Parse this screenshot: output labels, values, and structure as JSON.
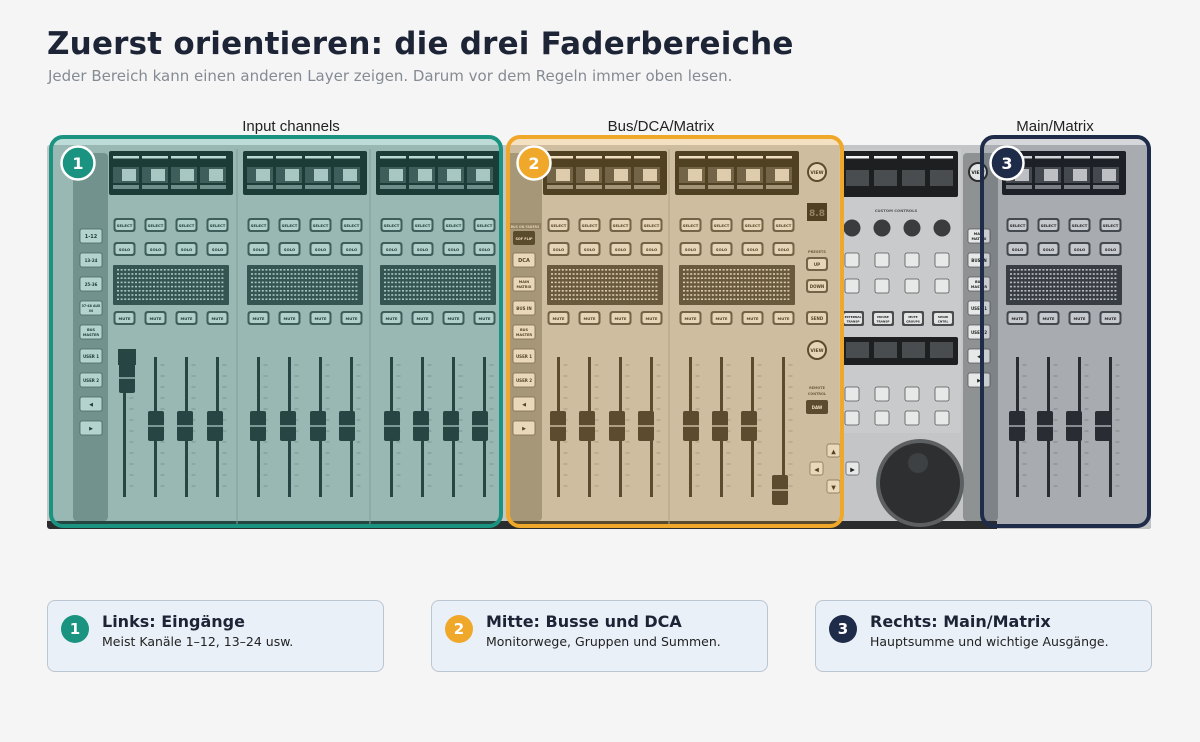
{
  "header": {
    "title": "Zuerst orientieren: die drei Faderbereiche",
    "subtitle": "Jeder Bereich kann einen anderen Layer zeigen. Darum vor dem Regeln immer oben lesen."
  },
  "regions": [
    {
      "number": "1",
      "label": "Input channels",
      "color": "#1a9480"
    },
    {
      "number": "2",
      "label": "Bus/DCA/Matrix",
      "color": "#f0a82a"
    },
    {
      "number": "3",
      "label": "Main/Matrix",
      "color": "#1f2c49"
    }
  ],
  "console": {
    "button_labels": {
      "select": "SELECT",
      "solo": "SOLO",
      "mute": "MUTE"
    },
    "left_layer_buttons": [
      "1-12",
      "13-24",
      "25-36",
      "37-48 AUX IN",
      "BUS MASTER",
      "USER 1",
      "USER 2",
      "◀",
      "▶"
    ],
    "middle_layer_buttons": [
      "DCA",
      "MAIN MATRIX",
      "BUS IN",
      "BUS MASTER",
      "USER 1",
      "USER 2",
      "◀",
      "▶"
    ],
    "middle_top_labels": {
      "layer_bar": "BUS ON FADERS",
      "flip": "SOF FLIP"
    },
    "right_layer_buttons": [
      "MAIN MATRIX",
      "BUS IN",
      "BUS MASTER",
      "USER 1",
      "USER 2",
      "◀",
      "▶"
    ],
    "nav": {
      "view": "VIEW",
      "display": "8.8",
      "presets": "PRESETS",
      "up": "UP",
      "down": "DOWN",
      "send": "SEND",
      "view2": "VIEW",
      "remote": "REMOTE CONTROL",
      "daw": "DAW"
    },
    "custom_controls": {
      "title": "CUSTOM CONTROLS",
      "mid_buttons": [
        "EXTERNAL TRANSP",
        "MOUSE TRANSP",
        "MUTE GROUPS",
        "SHOW CNTRL"
      ]
    }
  },
  "cards": [
    {
      "number": "1",
      "title": "Links: Eingänge",
      "desc": "Meist Kanäle 1–12, 13–24 usw."
    },
    {
      "number": "2",
      "title": "Mitte: Busse und DCA",
      "desc": "Monitorwege, Gruppen und Summen."
    },
    {
      "number": "3",
      "title": "Rechts: Main/Matrix",
      "desc": "Hauptsumme und wichtige Ausgänge."
    }
  ]
}
